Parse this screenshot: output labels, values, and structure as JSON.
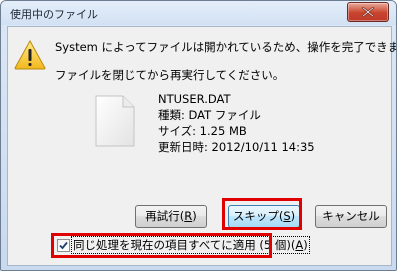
{
  "window": {
    "title": "使用中のファイル"
  },
  "message": {
    "line1": "System によってファイルは開かれているため、操作を完了できません。",
    "line2": "ファイルを閉じてから再実行してください。"
  },
  "file": {
    "name": "NTUSER.DAT",
    "type": "種類: DAT ファイル",
    "size": "サイズ: 1.25 MB",
    "modified": "更新日時: 2012/10/11 14:35"
  },
  "buttons": {
    "retry_label": "再試行",
    "retry_key": "R",
    "skip_label": "スキップ",
    "skip_key": "S",
    "cancel_label": "キャンセル"
  },
  "apply_all": {
    "label": "同じ処理を現在の項目すべてに適用 (5 個)",
    "key": "A",
    "checked": true
  },
  "icons": {
    "warning": "warning-icon",
    "file": "file-icon",
    "close": "close-icon",
    "check": "checkmark-icon"
  },
  "colors": {
    "highlight": "#e00000",
    "close_button": "#c8442c"
  }
}
